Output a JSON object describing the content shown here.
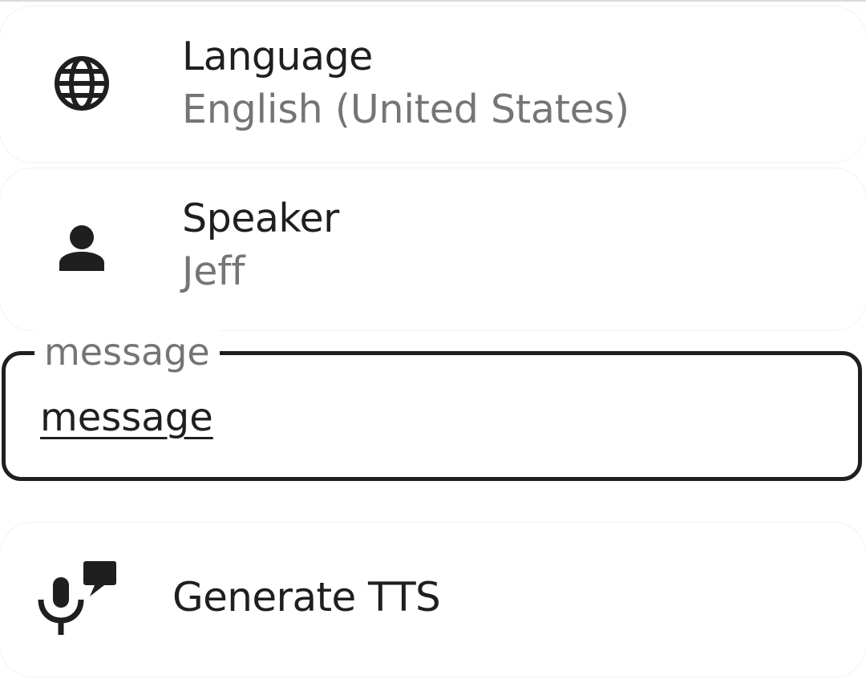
{
  "settings": {
    "language": {
      "icon": "globe-icon",
      "title": "Language",
      "value": "English (United States)"
    },
    "speaker": {
      "icon": "person-icon",
      "title": "Speaker",
      "value": "Jeff"
    }
  },
  "message_field": {
    "label": "message",
    "value": "message"
  },
  "generate": {
    "icon": "record-voice-icon",
    "label": "Generate TTS"
  },
  "colors": {
    "primary_text": "#1f1f1f",
    "secondary_text": "#757575",
    "background": "#ffffff"
  }
}
